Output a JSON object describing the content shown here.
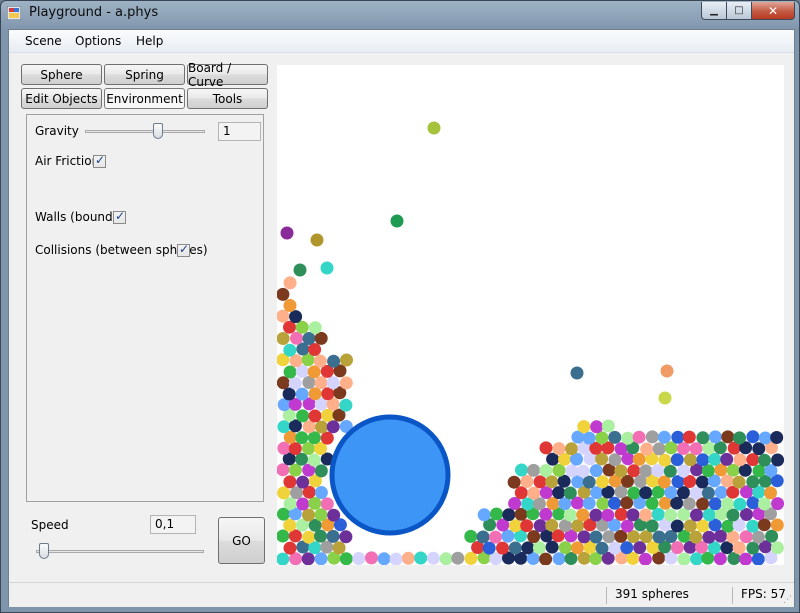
{
  "window": {
    "title": "Playground - a.phys"
  },
  "menu": [
    "Scene",
    "Options",
    "Help"
  ],
  "tool_buttons": {
    "sphere": "Sphere",
    "spring": "Spring",
    "board_curve": "Board / Curve",
    "edit_objects": "Edit Objects",
    "environment": "Environment",
    "tools": "Tools"
  },
  "environment": {
    "gravity_label": "Gravity",
    "gravity_value": "1",
    "gravity_slider_level": 0.62,
    "air_friction_label": "Air Friction",
    "air_friction_checked": true,
    "walls_label": "Walls (bounds)",
    "walls_checked": true,
    "collisions_label": "Collisions (between spheres)",
    "collisions_checked": true
  },
  "speed": {
    "label": "Speed",
    "value": "0,1",
    "slider_level": 0.02
  },
  "go_button": "GO",
  "status": {
    "spheres": "391 spheres",
    "fps": "FPS: 57"
  },
  "colors": {
    "big_sphere": "#3d95f5",
    "big_sphere_stroke": "#0a56c7"
  },
  "sphere_palette": [
    "#e03636",
    "#35b84a",
    "#2a5fd9",
    "#f0d23a",
    "#c03ad0",
    "#34d6c8",
    "#f09a35",
    "#8ad14a",
    "#1a2a5a",
    "#7b3a1e",
    "#f26fb6",
    "#9f9f9f",
    "#66a7ff",
    "#2f8f5a",
    "#b9a23a",
    "#6d2f9a",
    "#ffb08a",
    "#aaf0a0",
    "#d4d4ff",
    "#3b6f8f"
  ]
}
